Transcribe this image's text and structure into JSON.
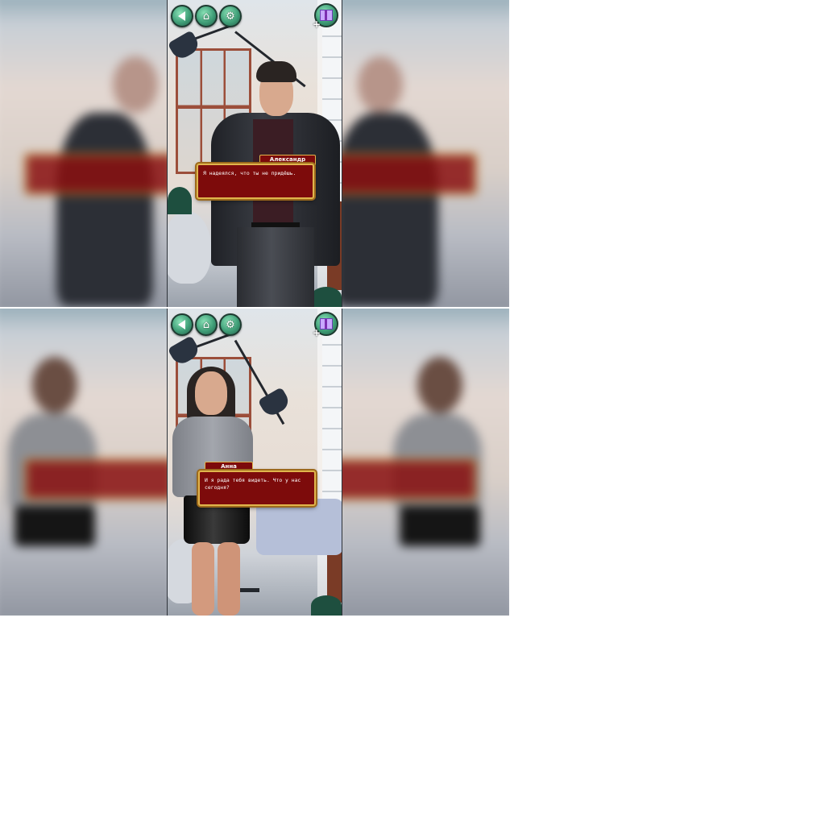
{
  "colors": {
    "dialogue_bg": "#7d0b0b",
    "dialogue_border": "#e0b54c",
    "hud_button": "#3f9e77",
    "gift_icon": "#c9a8ff"
  },
  "hud": {
    "back_icon": "back-arrow-icon",
    "wardrobe_icon": "clothes-hanger-icon",
    "settings_icon": "gear-icon",
    "gift_icon": "gift-box-icon",
    "gift_plus": "+"
  },
  "frames": [
    {
      "speaker": "Александр",
      "line": "Я надеялся, что ты не придёшь."
    },
    {
      "speaker": "Анна",
      "line": "И я рада тебя видеть. Что у нас сегодня?"
    }
  ]
}
